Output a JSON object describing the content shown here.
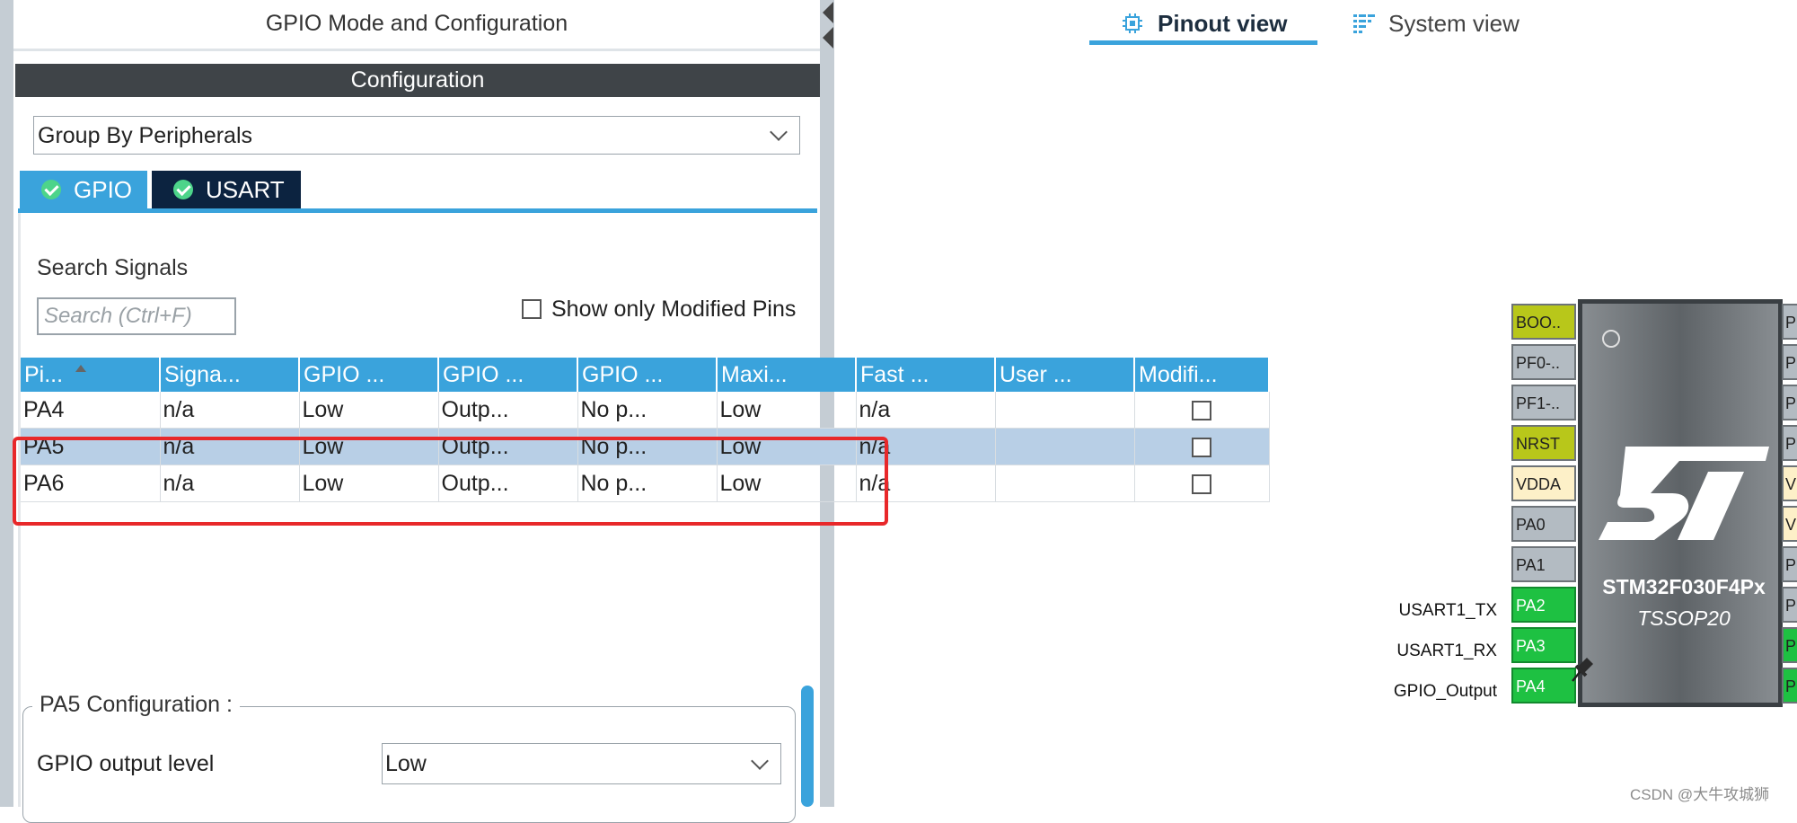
{
  "panel_title": "GPIO Mode and Configuration",
  "config_header": "Configuration",
  "group_by": {
    "value": "Group By Peripherals"
  },
  "tabs": [
    {
      "label": "GPIO",
      "active": true
    },
    {
      "label": "USART",
      "active": false
    }
  ],
  "search": {
    "label": "Search Signals",
    "placeholder": "Search (Ctrl+F)"
  },
  "show_modified_label": "Show only Modified Pins",
  "table": {
    "columns": [
      "Pi...",
      "Signa...",
      "GPIO ...",
      "GPIO ...",
      "GPIO ...",
      "Maxi...",
      "Fast ...",
      "User ...",
      "Modifi..."
    ],
    "rows": [
      [
        "PA4",
        "n/a",
        "Low",
        "Outp...",
        "No p...",
        "Low",
        "n/a",
        ""
      ],
      [
        "PA5",
        "n/a",
        "Low",
        "Outp...",
        "No p...",
        "Low",
        "n/a",
        ""
      ],
      [
        "PA6",
        "n/a",
        "Low",
        "Outp...",
        "No p...",
        "Low",
        "n/a",
        ""
      ]
    ],
    "selected_row": 1
  },
  "pa5_config": {
    "legend": "PA5 Configuration :",
    "output_level_label": "GPIO output level",
    "output_level_value": "Low"
  },
  "views": {
    "pinout": "Pinout view",
    "system": "System view"
  },
  "chip": {
    "name": "STM32F030F4Px",
    "package": "TSSOP20",
    "left_pins": [
      {
        "label": "BOO..",
        "color": "yellow"
      },
      {
        "label": "PF0-..",
        "color": "gray"
      },
      {
        "label": "PF1-..",
        "color": "gray"
      },
      {
        "label": "NRST",
        "color": "yellow"
      },
      {
        "label": "VDDA",
        "color": "cream"
      },
      {
        "label": "PA0",
        "color": "gray"
      },
      {
        "label": "PA1",
        "color": "gray"
      },
      {
        "label": "PA2",
        "color": "green"
      },
      {
        "label": "PA3",
        "color": "green"
      },
      {
        "label": "PA4",
        "color": "green"
      }
    ],
    "right_pins": [
      {
        "label": "P",
        "color": "gray"
      },
      {
        "label": "P",
        "color": "gray"
      },
      {
        "label": "P",
        "color": "gray"
      },
      {
        "label": "P",
        "color": "gray"
      },
      {
        "label": "V",
        "color": "cream"
      },
      {
        "label": "V",
        "color": "cream"
      },
      {
        "label": "P",
        "color": "gray"
      },
      {
        "label": "P",
        "color": "gray"
      },
      {
        "label": "P",
        "color": "green"
      },
      {
        "label": "P",
        "color": "green"
      }
    ],
    "signals": [
      "USART1_TX",
      "USART1_RX",
      "GPIO_Output"
    ]
  },
  "watermark": "CSDN @大牛攻城狮",
  "colors": {
    "accent": "#3aa3dc",
    "highlight": "#e8282a",
    "pin_green": "#1ec142",
    "tab_dark": "#0c2340"
  }
}
